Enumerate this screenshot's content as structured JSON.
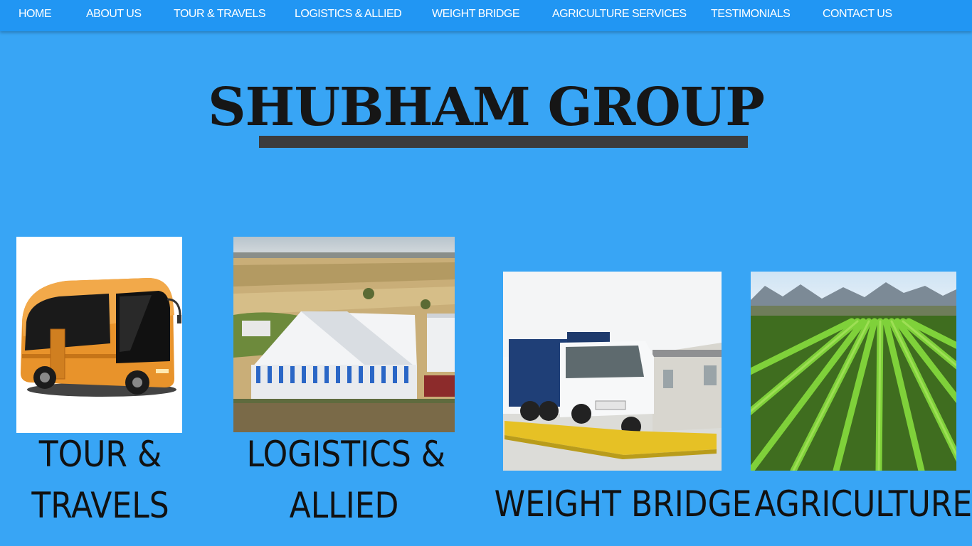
{
  "nav": {
    "items": [
      {
        "label": "HOME"
      },
      {
        "label": "ABOUT US"
      },
      {
        "label": "TOUR & TRAVELS"
      },
      {
        "label": "LOGISTICS & ALLIED"
      },
      {
        "label": "WEIGHT BRIDGE"
      },
      {
        "label": "AGRICULTURE SERVICES"
      },
      {
        "label": "TESTIMONIALS"
      },
      {
        "label": "CONTACT US"
      }
    ]
  },
  "hero": {
    "title": "SHUBHAM GROUP"
  },
  "services": [
    {
      "line1": "TOUR &",
      "line2": "TRAVELS",
      "image": "bus-image"
    },
    {
      "line1": "LOGISTICS &",
      "line2": "ALLIED",
      "image": "warehouse-image"
    },
    {
      "line1": "WEIGHT BRIDGE",
      "image": "weighbridge-truck-image"
    },
    {
      "line1": "AGRICULTURE",
      "image": "crop-field-image"
    }
  ],
  "colors": {
    "background": "#38a5f5",
    "navbar": "#2196f3",
    "title": "#161616",
    "title_underline": "#3c3c3c"
  }
}
